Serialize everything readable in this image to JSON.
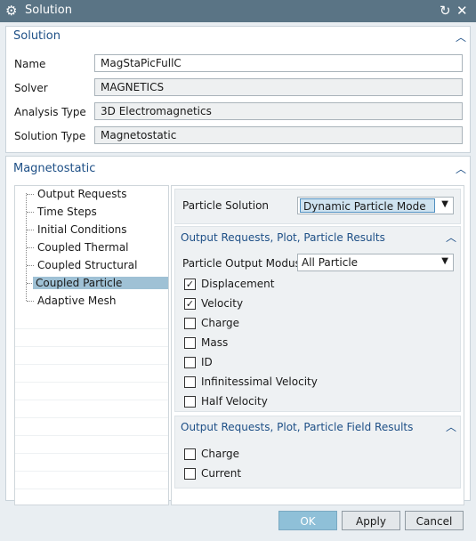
{
  "window": {
    "title": "Solution"
  },
  "solution_group": {
    "title": "Solution",
    "fields": [
      {
        "label": "Name",
        "value": "MagStaPicFullC"
      },
      {
        "label": "Solver",
        "value": "MAGNETICS"
      },
      {
        "label": "Analysis Type",
        "value": "3D Electromagnetics"
      },
      {
        "label": "Solution Type",
        "value": "Magnetostatic"
      }
    ]
  },
  "magnetostatic_group": {
    "title": "Magnetostatic",
    "tree": [
      {
        "label": "Output Requests"
      },
      {
        "label": "Time Steps"
      },
      {
        "label": "Initial Conditions"
      },
      {
        "label": "Coupled Thermal"
      },
      {
        "label": "Coupled Structural"
      },
      {
        "label": "Coupled Particle",
        "selected": true
      },
      {
        "label": "Adaptive Mesh"
      }
    ],
    "particle_solution": {
      "label": "Particle Solution",
      "value": "Dynamic Particle Mode"
    },
    "particle_results": {
      "title": "Output Requests, Plot, Particle Results",
      "modus_label": "Particle Output Modus",
      "modus_value": "All Particle",
      "checkboxes": [
        {
          "label": "Displacement",
          "checked": true
        },
        {
          "label": "Velocity",
          "checked": true
        },
        {
          "label": "Charge",
          "checked": false
        },
        {
          "label": "Mass",
          "checked": false
        },
        {
          "label": "ID",
          "checked": false
        },
        {
          "label": "Infinitessimal Velocity",
          "checked": false
        },
        {
          "label": "Half Velocity",
          "checked": false
        }
      ]
    },
    "field_results": {
      "title": "Output Requests, Plot, Particle Field Results",
      "checkboxes": [
        {
          "label": "Charge",
          "checked": false
        },
        {
          "label": "Current",
          "checked": false
        }
      ]
    }
  },
  "buttons": {
    "ok": "OK",
    "apply": "Apply",
    "cancel": "Cancel"
  },
  "icons": {
    "title": "gear-icon",
    "reset": "reset-icon",
    "close": "close-icon",
    "collapse": "chevron-up-icon",
    "dropdown": "dropdown-arrow-icon",
    "check": "checkmark-icon"
  }
}
